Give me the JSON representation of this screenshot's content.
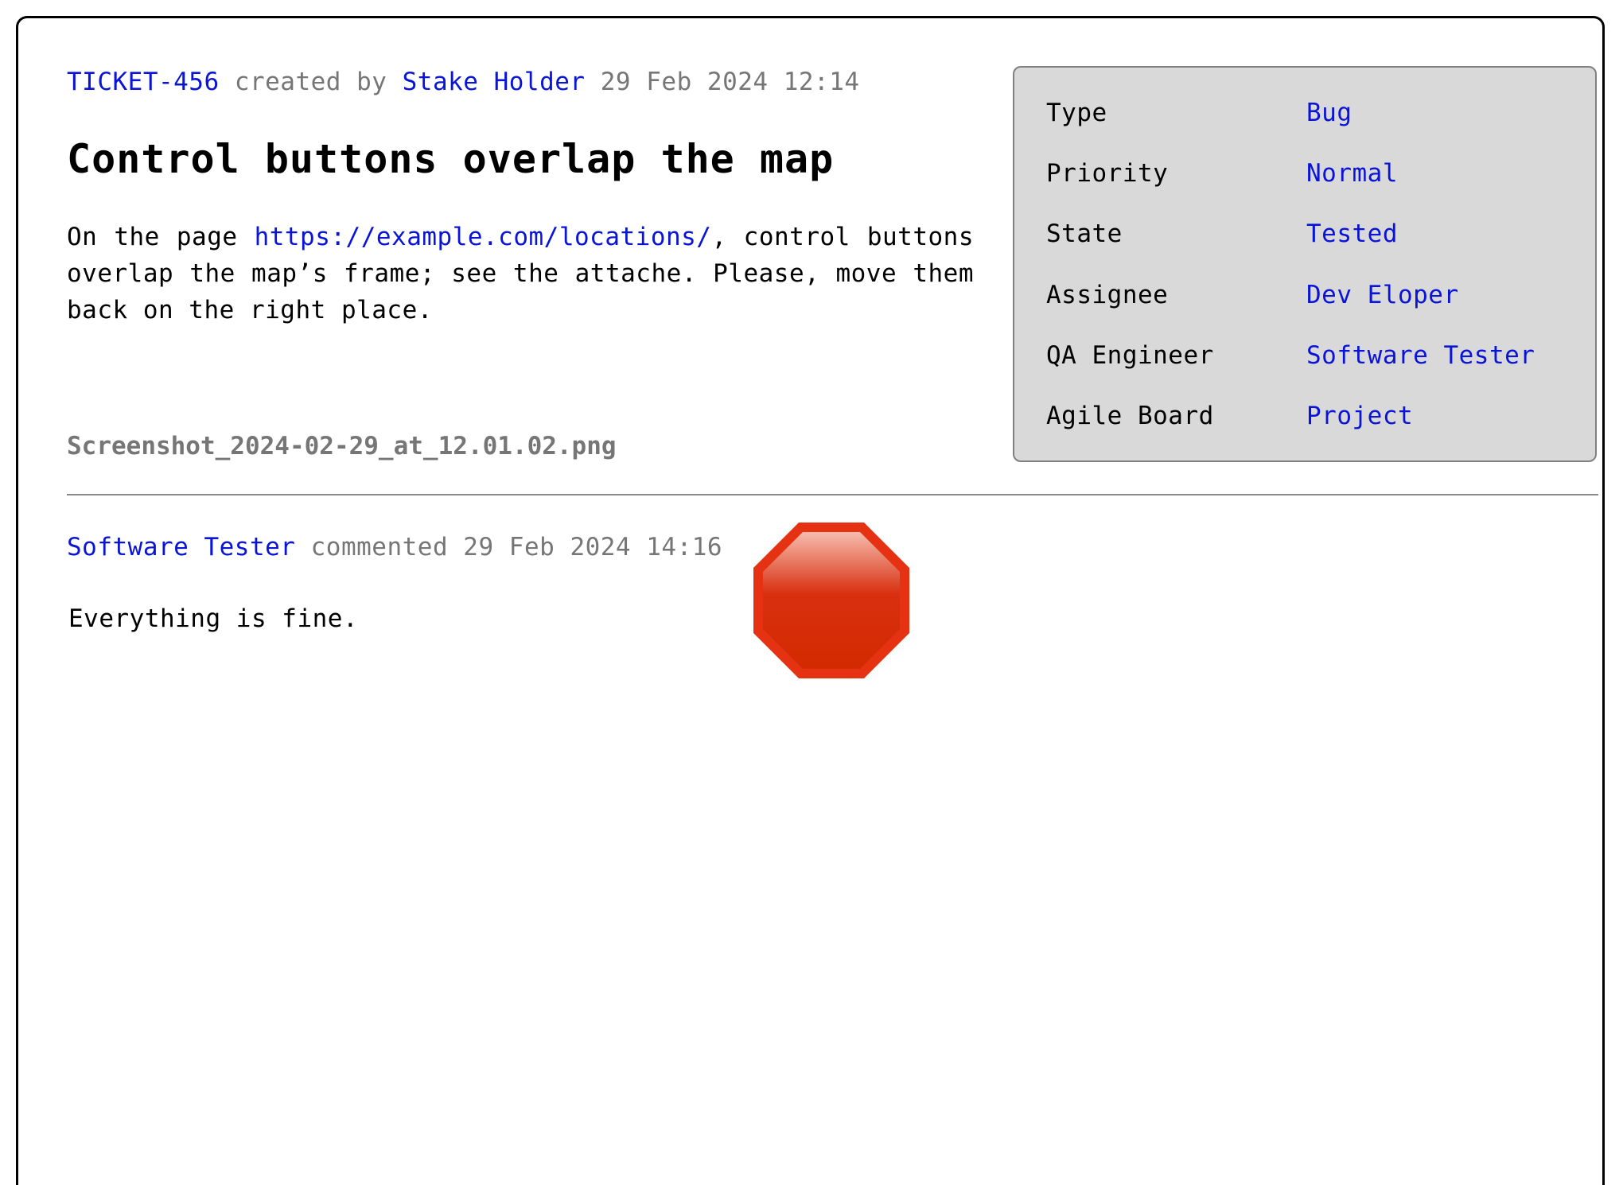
{
  "ticket": {
    "id": "TICKET-456",
    "created_by_text": "created by",
    "author": "Stake Holder",
    "created_at": "29 Feb 2024 12:14",
    "title": "Control buttons overlap the map",
    "description_before_link": "On the page ",
    "description_link": "https://example.com/locations/",
    "description_after_link": ", control buttons overlap the map’s frame; see the attache. Please, move them back on the right place.",
    "attachment": "Screenshot_2024-02-29_at_12.01.02.png"
  },
  "properties": [
    {
      "name": "Type",
      "value": "Bug"
    },
    {
      "name": "Priority",
      "value": "Normal"
    },
    {
      "name": "State",
      "value": "Tested"
    },
    {
      "name": "Assignee",
      "value": "Dev Eloper"
    },
    {
      "name": "QA Engineer",
      "value": "Software Tester"
    },
    {
      "name": "Agile Board",
      "value": "Project"
    }
  ],
  "comment": {
    "author": "Software Tester",
    "action_text": "commented",
    "timestamp": "29 Feb 2024 14:16",
    "body": "Everything is fine.",
    "reaction_icon": "stop-sign-icon"
  },
  "colors": {
    "link": "#0a14d8",
    "muted": "#767676",
    "panel_bg": "#d9d9d9",
    "stop_red": "#d42a00"
  }
}
